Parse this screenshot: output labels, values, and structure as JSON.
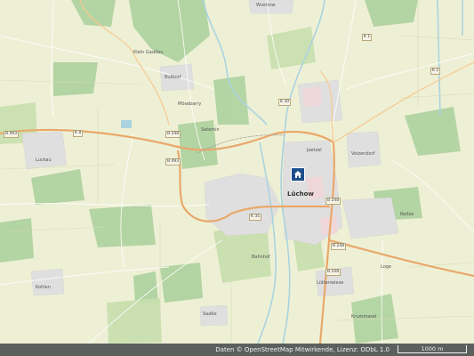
{
  "map": {
    "towns": {
      "luchow": "Lüchow",
      "loge": "Loge"
    },
    "places": {
      "wustrow": "Wustrow",
      "klein_gaddau": "Klein Gaddau",
      "moesebarry": "Mösebarry",
      "bustorf": "Bußtorf",
      "luckau": "Luckau",
      "satemin": "Satemin",
      "jeetzel": "Jeetzel",
      "kohlen": "Kohlen",
      "saaße": "Saaße",
      "krummasel": "Krummasel",
      "volzendorf": "Volzendorf",
      "reitze": "Reitze",
      "lutzelandeichen": "Lüttenwiese",
      "bahn": "Bahnhof"
    },
    "roads": [
      "K 30",
      "B 493",
      "B 248",
      "K 8",
      "K 2",
      "K 1",
      "B 248",
      "K 35",
      "B 493",
      "B 248",
      "B 248"
    ],
    "marker_icon": "home-icon"
  },
  "footer": {
    "attribution": "Daten © OpenStreetMap Mitwirkende, Lizenz: ODbL 1.0",
    "scale": "1000 m"
  }
}
